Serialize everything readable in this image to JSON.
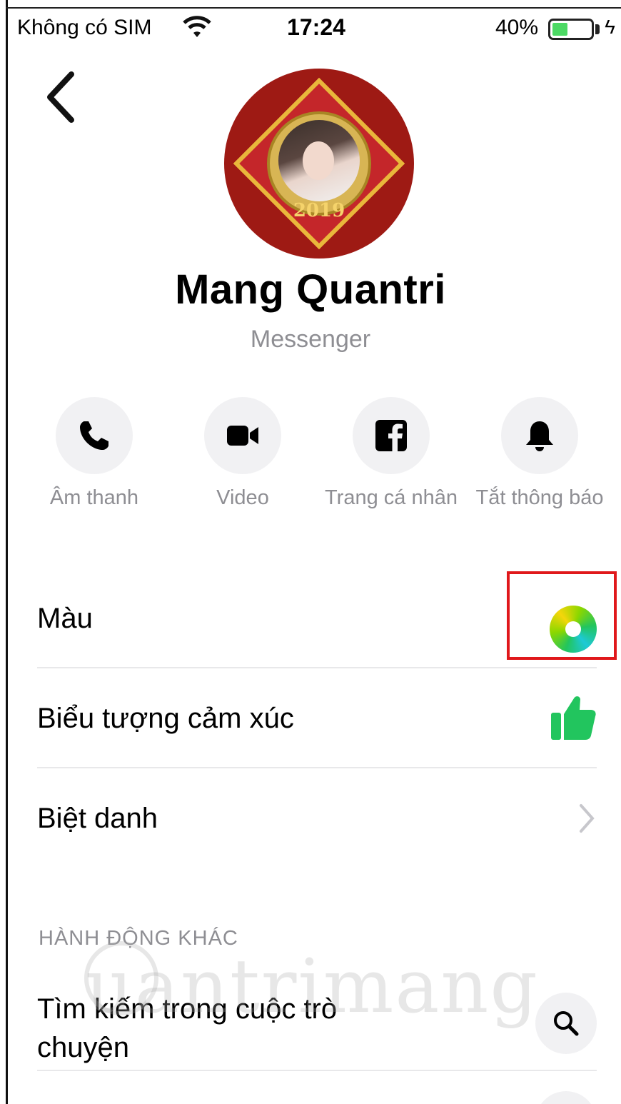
{
  "status_bar": {
    "carrier": "Không có SIM",
    "time": "17:24",
    "battery": "40%",
    "battery_level": 0.4
  },
  "profile": {
    "name": "Mang Quantri",
    "subtitle": "Messenger",
    "avatar_text": "2019"
  },
  "actions": [
    {
      "label": "Âm thanh",
      "icon": "phone-icon"
    },
    {
      "label": "Video",
      "icon": "video-camera-icon"
    },
    {
      "label": "Trang cá nhân",
      "icon": "facebook-icon"
    },
    {
      "label": "Tắt thông báo",
      "icon": "bell-icon"
    }
  ],
  "settings": {
    "color_label": "Màu",
    "emoji_label": "Biểu tượng cảm xúc",
    "nickname_label": "Biệt danh"
  },
  "more_actions": {
    "header": "HÀNH ĐỘNG KHÁC",
    "search_label": "Tìm kiếm trong cuộc trò chuyện"
  },
  "colors": {
    "accent_green": "#22c55e",
    "highlight_red": "#e0181b",
    "secondary_text": "#8e8e93"
  },
  "watermark": "uantrimang"
}
